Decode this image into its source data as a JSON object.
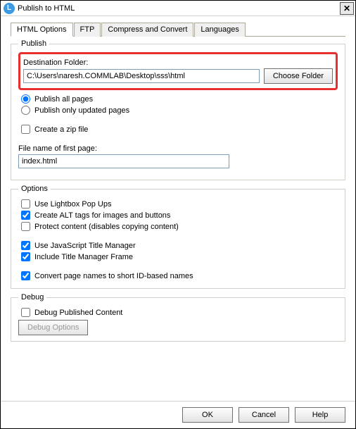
{
  "window": {
    "title": "Publish to HTML"
  },
  "tabs": {
    "html": "HTML Options",
    "ftp": "FTP",
    "compress": "Compress and Convert",
    "languages": "Languages"
  },
  "publish": {
    "legend": "Publish",
    "dest_label": "Destination Folder:",
    "dest_value": "C:\\Users\\naresh.COMMLAB\\Desktop\\sss\\html",
    "choose_folder": "Choose Folder",
    "radio_all": "Publish all pages",
    "radio_updated": "Publish only updated pages",
    "create_zip": "Create a zip file",
    "file_label": "File name of first page:",
    "file_value": "index.html"
  },
  "options": {
    "legend": "Options",
    "lightbox": "Use Lightbox Pop Ups",
    "alt_tags": "Create ALT tags for images and buttons",
    "protect": "Protect content (disables copying content)",
    "js_title": "Use JavaScript Title Manager",
    "title_frame": "Include Title Manager Frame",
    "short_names": "Convert page names to short ID-based names"
  },
  "debug": {
    "legend": "Debug",
    "debug_pub": "Debug Published Content",
    "debug_opts": "Debug Options"
  },
  "buttons": {
    "ok": "OK",
    "cancel": "Cancel",
    "help": "Help"
  }
}
